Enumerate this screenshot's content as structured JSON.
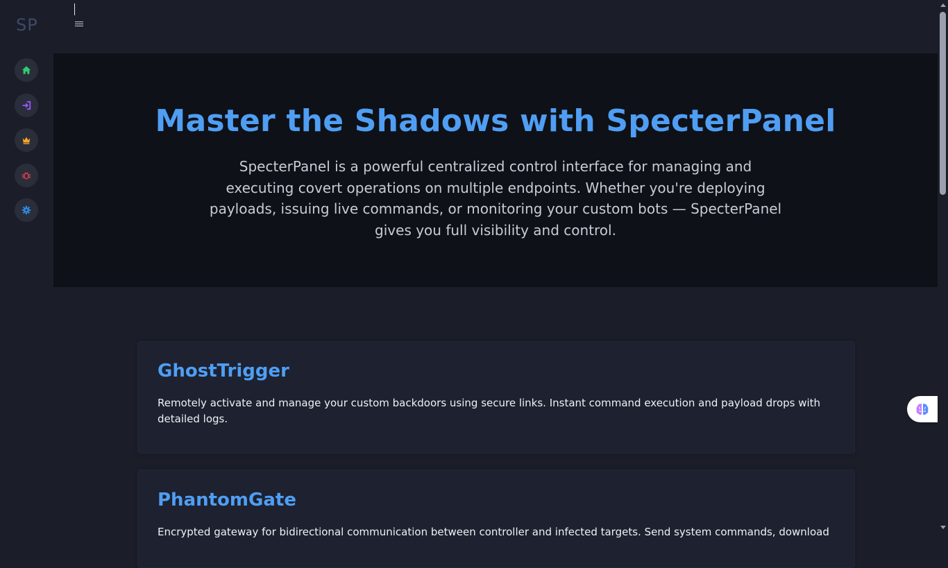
{
  "sidebar": {
    "logo": "SP",
    "items": [
      {
        "icon": "home-icon",
        "color": "#2ecc71"
      },
      {
        "icon": "sign-in-icon",
        "color": "#9b59ff"
      },
      {
        "icon": "crown-icon",
        "color": "#f5a623"
      },
      {
        "icon": "bug-icon",
        "color": "#e0404f"
      },
      {
        "icon": "gear-icon",
        "color": "#2f8ff0"
      }
    ]
  },
  "topbar": {
    "menu_icon": "hamburger-menu-icon"
  },
  "hero": {
    "title": "Master the Shadows with SpecterPanel",
    "description": "SpecterPanel is a powerful centralized control interface for managing and executing covert operations on multiple endpoints. Whether you're deploying payloads, issuing live commands, or monitoring your custom bots — SpecterPanel gives you full visibility and control."
  },
  "features": [
    {
      "title": "GhostTrigger",
      "description": "Remotely activate and manage your custom backdoors using secure links. Instant command execution and payload drops with detailed logs."
    },
    {
      "title": "PhantomGate",
      "description": "Encrypted gateway for bidirectional communication between controller and infected targets. Send system commands, download results"
    }
  ],
  "floating_button": {
    "icon": "brain-icon"
  },
  "colors": {
    "accent": "#4f9ef3",
    "background": "#1b1e29",
    "hero_background": "#0f1118"
  }
}
